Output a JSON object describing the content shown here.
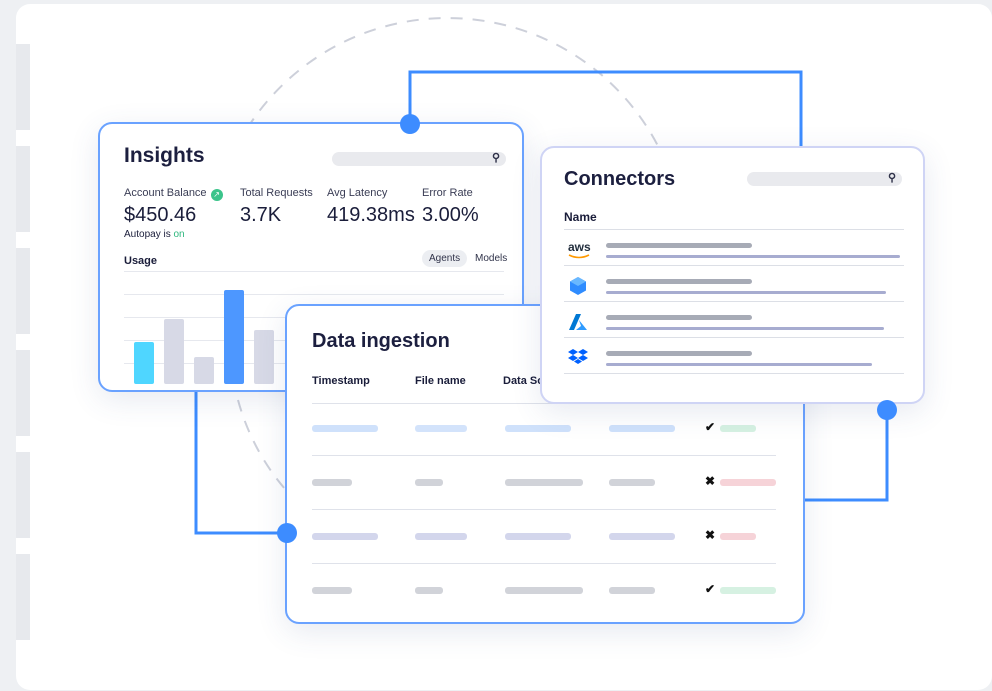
{
  "colors": {
    "accent": "#3d8cff",
    "positive": "#2eb67d",
    "bar_highlight": "#4d97ff",
    "bar_cyan": "#4fd6ff",
    "bar_muted": "#d7d9e6",
    "ok_badge": "#d6f1e2",
    "error_badge": "#f6d3d8"
  },
  "insights": {
    "title": "Insights",
    "search_icon": "magnifier-icon",
    "metrics": [
      {
        "label": "Account Balance",
        "value": "$450.46",
        "trend_icon": "arrow-up-right-icon"
      },
      {
        "label": "Total Requests",
        "value": "3.7K"
      },
      {
        "label": "Avg Latency",
        "value": "419.38ms"
      },
      {
        "label": "Error Rate",
        "value": "3.00%"
      }
    ],
    "autopay_prefix": "Autopay is",
    "autopay_status": "on",
    "usage_title": "Usage",
    "toggles": [
      "Agents",
      "Models"
    ],
    "active_toggle": "Agents",
    "usage_bars": [
      0.45,
      0.69,
      0.29,
      1.0,
      0.57
    ]
  },
  "connectors": {
    "title": "Connectors",
    "search_icon": "magnifier-icon",
    "column_header": "Name",
    "items": [
      {
        "logo": "aws",
        "logo_text": "aws"
      },
      {
        "logo": "hexagon-icon"
      },
      {
        "logo": "azure-icon"
      },
      {
        "logo": "dropbox-icon"
      }
    ]
  },
  "ingestion": {
    "title": "Data ingestion",
    "columns": [
      "Timestamp",
      "File name",
      "Data So"
    ],
    "rows": [
      {
        "status": "ok",
        "symbol": "✔"
      },
      {
        "status": "error",
        "symbol": "✖"
      },
      {
        "status": "error",
        "symbol": "✖"
      },
      {
        "status": "ok",
        "symbol": "✔"
      }
    ]
  }
}
